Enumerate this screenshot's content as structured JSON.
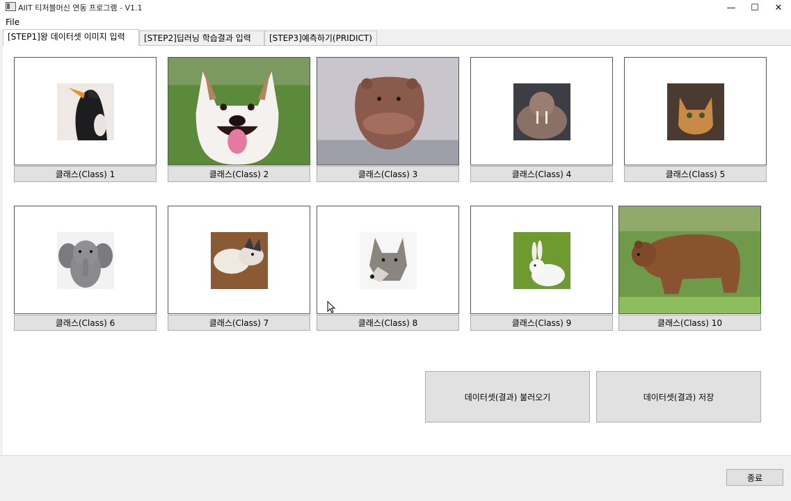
{
  "window": {
    "title": "AIIT 티처블머신 연동 프로그램 - V1.1",
    "minimize_glyph": "—",
    "maximize_glyph": "☐",
    "close_glyph": "✕"
  },
  "menu": {
    "file": "File"
  },
  "tabs": [
    {
      "label": "[STEP1]왕 데이터셋 이미지 입력",
      "active": true
    },
    {
      "label": "[STEP2]딥러닝 학습결과 입력",
      "active": false
    },
    {
      "label": "[STEP3]예측하기(PRIDICT)",
      "active": false
    }
  ],
  "classes": [
    {
      "label": "클래스(Class) 1",
      "image": "penguin-image"
    },
    {
      "label": "클래스(Class) 2",
      "image": "dog-image"
    },
    {
      "label": "클래스(Class) 3",
      "image": "hippo-image"
    },
    {
      "label": "클래스(Class) 4",
      "image": "walrus-image"
    },
    {
      "label": "클래스(Class) 5",
      "image": "cat-image"
    },
    {
      "label": "클래스(Class) 6",
      "image": "elephant-toy-image"
    },
    {
      "label": "클래스(Class) 7",
      "image": "sleeping-dogs-image"
    },
    {
      "label": "클래스(Class) 8",
      "image": "wolf-image"
    },
    {
      "label": "클래스(Class) 9",
      "image": "rabbit-image"
    },
    {
      "label": "클래스(Class) 10",
      "image": "bear-image"
    }
  ],
  "actions": {
    "load_label": "데이터셋(결과) 불러오기",
    "save_label": "데이터셋(결과) 저장"
  },
  "footer": {
    "exit_label": "종료"
  }
}
